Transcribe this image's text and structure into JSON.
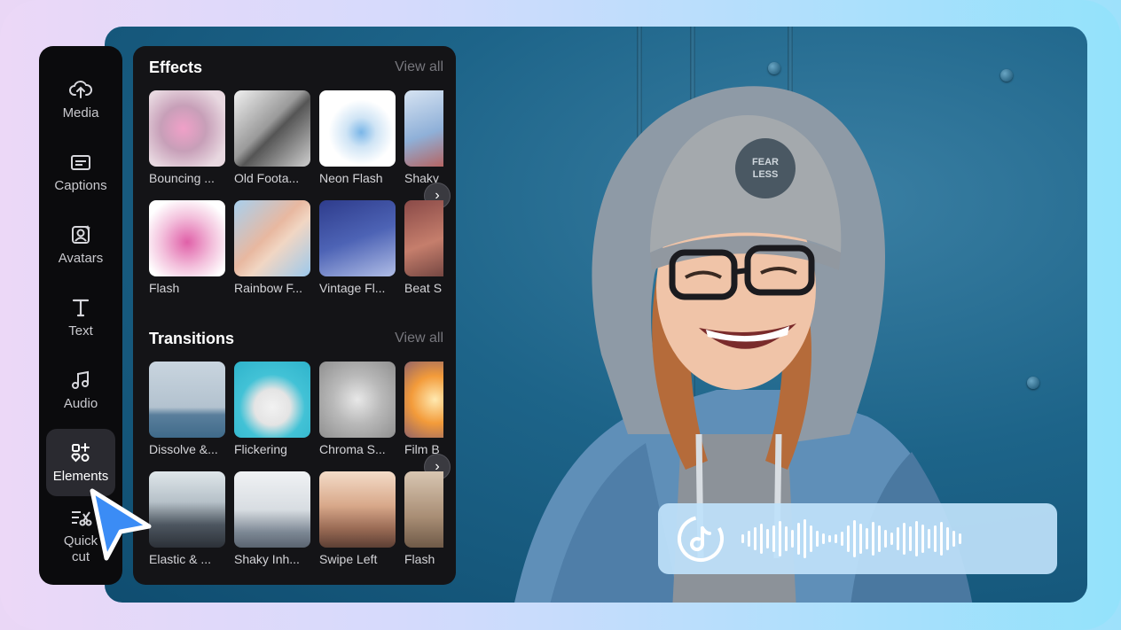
{
  "nav": {
    "items": [
      {
        "label": "Media",
        "icon": "cloud-upload-icon"
      },
      {
        "label": "Captions",
        "icon": "captions-icon"
      },
      {
        "label": "Avatars",
        "icon": "avatar-icon"
      },
      {
        "label": "Text",
        "icon": "text-icon"
      },
      {
        "label": "Audio",
        "icon": "music-note-icon"
      },
      {
        "label": "Elements",
        "icon": "elements-icon",
        "active": true
      },
      {
        "label": "Quick cut",
        "icon": "quick-cut-icon"
      }
    ]
  },
  "effects": {
    "title": "Effects",
    "view_all": "View all",
    "row1": [
      "Bouncing ...",
      "Old Foota...",
      "Neon Flash",
      "Shaky"
    ],
    "row2": [
      "Flash",
      "Rainbow F...",
      "Vintage Fl...",
      "Beat S"
    ]
  },
  "transitions": {
    "title": "Transitions",
    "view_all": "View all",
    "row1": [
      "Dissolve &...",
      "Flickering",
      "Chroma S...",
      "Film B"
    ],
    "row2": [
      "Elastic & ...",
      "Shaky Inh...",
      "Swipe Left",
      "Flash"
    ]
  },
  "photo": {
    "beanie_text": "FEARLESS"
  },
  "colors": {
    "accent_blue": "#3b8cf5",
    "panel_bg": "#141417",
    "rail_bg": "#0b0b0d"
  }
}
